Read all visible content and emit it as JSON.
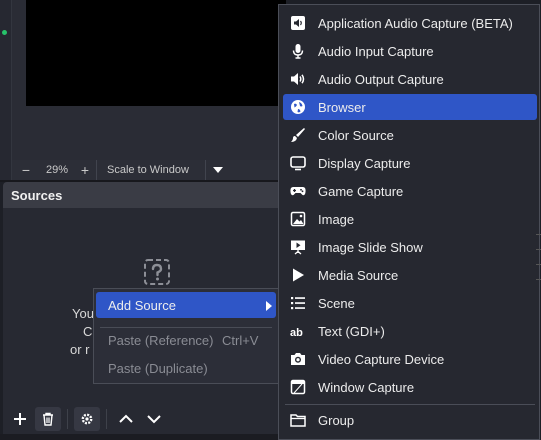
{
  "preview": {
    "zoom_minus": "−",
    "zoom_value": "29%",
    "zoom_plus": "+",
    "scale_mode": "Scale to Window"
  },
  "sources": {
    "title": "Sources",
    "empty_line1": "You",
    "empty_line2": "C",
    "empty_line3": "or r"
  },
  "context_menu": {
    "items": [
      {
        "label": "Add Source",
        "shortcut": "",
        "state": "active"
      },
      {
        "label": "Paste (Reference)",
        "shortcut": "Ctrl+V",
        "state": "disabled"
      },
      {
        "label": "Paste (Duplicate)",
        "shortcut": "",
        "state": "disabled"
      }
    ]
  },
  "add_source_menu": {
    "items": [
      {
        "label": "Application Audio Capture (BETA)",
        "icon": "speaker-app-icon"
      },
      {
        "label": "Audio Input Capture",
        "icon": "microphone-icon"
      },
      {
        "label": "Audio Output Capture",
        "icon": "speaker-icon"
      },
      {
        "label": "Browser",
        "icon": "globe-icon",
        "active": true
      },
      {
        "label": "Color Source",
        "icon": "paintbrush-icon"
      },
      {
        "label": "Display Capture",
        "icon": "monitor-icon"
      },
      {
        "label": "Game Capture",
        "icon": "gamepad-icon"
      },
      {
        "label": "Image",
        "icon": "image-icon"
      },
      {
        "label": "Image Slide Show",
        "icon": "slideshow-icon"
      },
      {
        "label": "Media Source",
        "icon": "play-icon"
      },
      {
        "label": "Scene",
        "icon": "list-icon"
      },
      {
        "label": "Text (GDI+)",
        "icon": "text-ab-icon"
      },
      {
        "label": "Video Capture Device",
        "icon": "camera-icon"
      },
      {
        "label": "Window Capture",
        "icon": "window-icon"
      },
      {
        "label": "Group",
        "icon": "folder-icon"
      }
    ]
  },
  "colors": {
    "accent": "#2f56c7",
    "panel": "#272932",
    "menu_bg": "#262830"
  }
}
